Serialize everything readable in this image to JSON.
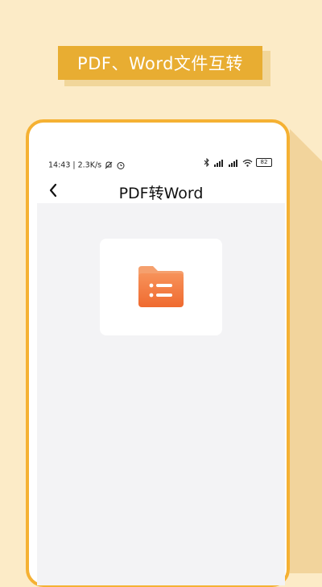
{
  "banner": {
    "text": "PDF、Word文件互转"
  },
  "status_bar": {
    "time_speed": "14:43 | 2.3K/s",
    "battery_level": "82",
    "icons": [
      "mute-icon",
      "alarm-icon",
      "bluetooth-icon",
      "signal-icon",
      "signal-icon",
      "wifi-icon",
      "battery-icon"
    ]
  },
  "nav": {
    "title": "PDF转Word",
    "back_icon": "chevron-left-icon"
  },
  "file_card": {
    "icon": "folder-list-icon"
  },
  "colors": {
    "background": "#fcebc7",
    "banner": "#e8ad32",
    "phone_border": "#f5b133",
    "folder_icon": "#f47a3a"
  }
}
